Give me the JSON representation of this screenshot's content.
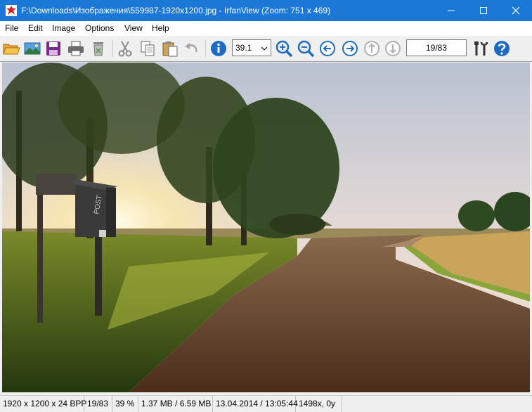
{
  "window": {
    "title": "F:\\Downloads\\Изображения\\559987-1920x1200.jpg - IrfanView (Zoom: 751 x 469)"
  },
  "menu": [
    "File",
    "Edit",
    "Image",
    "Options",
    "View",
    "Help"
  ],
  "toolbar": {
    "zoom_value": "39.1",
    "page_indicator": "19/83",
    "icons": [
      "open-folder-icon",
      "slideshow-icon",
      "save-icon",
      "print-icon",
      "delete-icon",
      "cut-icon",
      "copy-icon",
      "paste-icon",
      "undo-icon",
      "info-icon",
      "zoom-in-icon",
      "zoom-out-icon",
      "previous-icon",
      "next-icon",
      "first-icon",
      "last-icon",
      "settings-icon",
      "help-icon"
    ]
  },
  "status": {
    "dimensions": "1920 x 1200 x 24 BPP",
    "page": "19/83",
    "zoom": "39 %",
    "size": "1.37 MB / 6.59 MB",
    "date": "13.04.2014 / 13:05:44",
    "cursor": "1498x, 0y"
  },
  "colors": {
    "titlebar": "#1b78d6",
    "toolbar_blue": "#1e6bc4"
  }
}
